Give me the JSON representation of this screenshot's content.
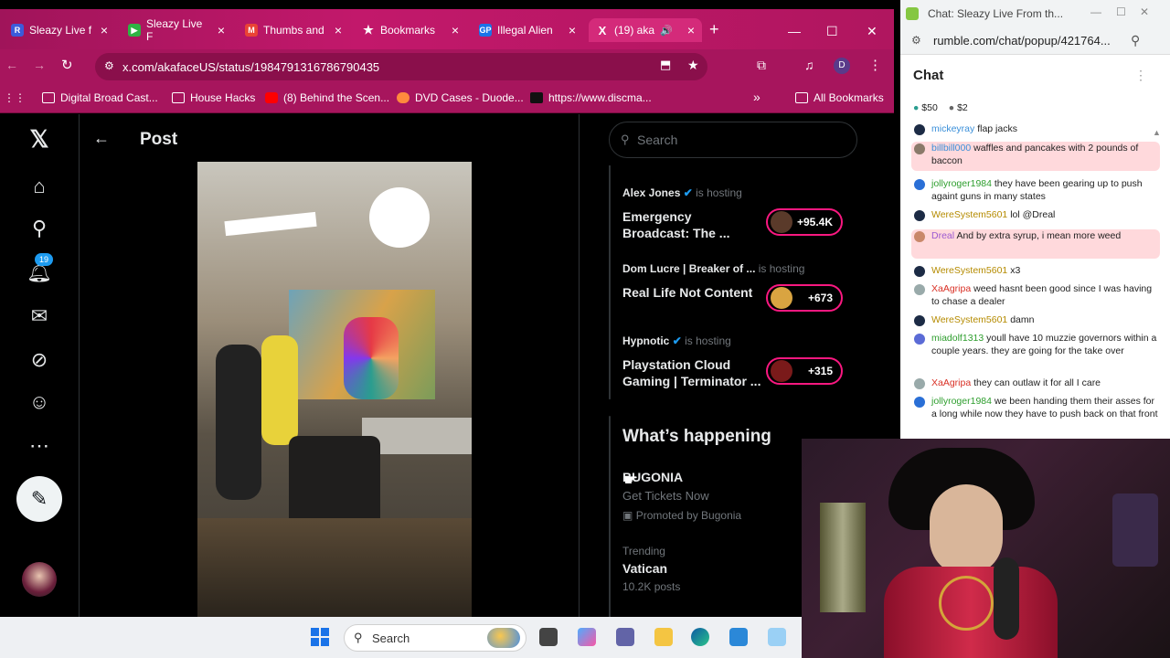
{
  "browser": {
    "tabs": [
      {
        "label": "Sleazy Live f",
        "fav_color": "#3b5bdb",
        "fav": "R"
      },
      {
        "label": "Sleazy Live F",
        "fav_color": "#2fb344",
        "fav": "▶"
      },
      {
        "label": "Thumbs and",
        "fav_color": "#ea4335",
        "fav": "M"
      },
      {
        "label": "Bookmarks",
        "fav_color": "#c2186b",
        "fav": "★"
      },
      {
        "label": "Illegal Alien",
        "fav_color": "#1a73e8",
        "fav": "GP"
      },
      {
        "label": "(19) aka",
        "fav_color": "#000000",
        "fav": "X"
      }
    ],
    "url": "x.com/akafaceUS/status/1984791316786790435",
    "profile_initial": "D",
    "bookmarks": [
      "Digital Broad Cast...",
      "House Hacks",
      "(8) Behind the Scen...",
      "DVD Cases - Duode...",
      "https://www.discma...",
      "All Bookmarks"
    ]
  },
  "x": {
    "header_title": "Post",
    "notification_count": "19",
    "search_placeholder": "Search",
    "spaces": [
      {
        "host": "Alex Jones",
        "hosting": "is hosting",
        "title_line1": "Emergency",
        "title_line2": "Broadcast: The ...",
        "count": "+95.4K"
      },
      {
        "host": "Dom Lucre | Breaker of ...",
        "hosting": "is hosting",
        "title_line1": "Real Life Not Content",
        "title_line2": "",
        "count": "+673"
      },
      {
        "host": "Hypnotic",
        "hosting": "is hosting",
        "title_line1": "Playstation Cloud",
        "title_line2": "Gaming | Terminator ...",
        "count": "+315"
      }
    ],
    "whats_happening": {
      "heading": "What’s happening",
      "promo_title": "BUGONIA",
      "promo_sub": "Get Tickets Now",
      "promo_by": "Promoted by Bugonia",
      "trend_label": "Trending",
      "trend_name": "Vatican",
      "trend_posts": "10.2K posts"
    }
  },
  "chat": {
    "window_title": "Chat: Sleazy Live From th...",
    "url": "rumble.com/chat/popup/421764...",
    "heading": "Chat",
    "tips": [
      "$50",
      "$2"
    ],
    "messages": [
      {
        "user": "mickeyray",
        "text": "flap jacks",
        "color": "#3a8fd9",
        "hl": false
      },
      {
        "user": "billbill000",
        "text": "waffles and pancakes with 2 pounds of baccon",
        "color": "#3a8fd9",
        "hl": true
      },
      {
        "user": "jollyroger1984",
        "text": "they have been gearing up to push againt guns in many states",
        "color": "#2e9e2e",
        "hl": false
      },
      {
        "user": "WereSystem5601",
        "text": "lol @Dreal",
        "color": "#b58b00",
        "hl": false
      },
      {
        "user": "Dreal",
        "text": "And by extra syrup, i mean more weed",
        "color": "#9b59d0",
        "hl": true
      },
      {
        "user": "WereSystem5601",
        "text": "x3",
        "color": "#b58b00",
        "hl": false
      },
      {
        "user": "XaAgripa",
        "text": "weed hasnt been good since I was having to chase a dealer",
        "color": "#d93025",
        "hl": false
      },
      {
        "user": "WereSystem5601",
        "text": "damn",
        "color": "#b58b00",
        "hl": false
      },
      {
        "user": "miadolf1313",
        "text": "youll have 10 muzzie governors within a couple years. they are going for the take over",
        "color": "#2e9e2e",
        "hl": false
      },
      {
        "user": "XaAgripa",
        "text": "they can outlaw it for all I care",
        "color": "#d93025",
        "hl": false
      },
      {
        "user": "jollyroger1984",
        "text": "we been handing them their asses for a long while now they have to push back on that front",
        "color": "#2e9e2e",
        "hl": false
      }
    ]
  },
  "taskbar": {
    "search_label": "Search"
  }
}
